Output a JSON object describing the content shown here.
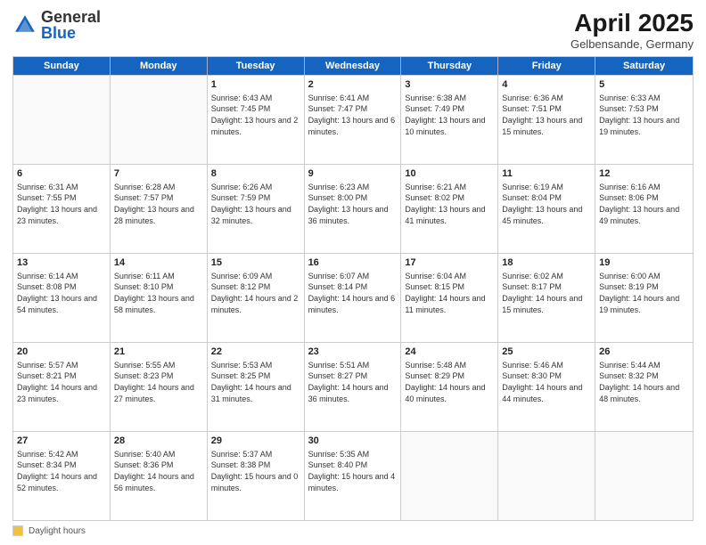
{
  "header": {
    "logo_general": "General",
    "logo_blue": "Blue",
    "month_title": "April 2025",
    "subtitle": "Gelbensande, Germany"
  },
  "days_of_week": [
    "Sunday",
    "Monday",
    "Tuesday",
    "Wednesday",
    "Thursday",
    "Friday",
    "Saturday"
  ],
  "legend_label": "Daylight hours",
  "weeks": [
    [
      {
        "day": "",
        "info": ""
      },
      {
        "day": "",
        "info": ""
      },
      {
        "day": "1",
        "info": "Sunrise: 6:43 AM\nSunset: 7:45 PM\nDaylight: 13 hours and 2 minutes."
      },
      {
        "day": "2",
        "info": "Sunrise: 6:41 AM\nSunset: 7:47 PM\nDaylight: 13 hours and 6 minutes."
      },
      {
        "day": "3",
        "info": "Sunrise: 6:38 AM\nSunset: 7:49 PM\nDaylight: 13 hours and 10 minutes."
      },
      {
        "day": "4",
        "info": "Sunrise: 6:36 AM\nSunset: 7:51 PM\nDaylight: 13 hours and 15 minutes."
      },
      {
        "day": "5",
        "info": "Sunrise: 6:33 AM\nSunset: 7:53 PM\nDaylight: 13 hours and 19 minutes."
      }
    ],
    [
      {
        "day": "6",
        "info": "Sunrise: 6:31 AM\nSunset: 7:55 PM\nDaylight: 13 hours and 23 minutes."
      },
      {
        "day": "7",
        "info": "Sunrise: 6:28 AM\nSunset: 7:57 PM\nDaylight: 13 hours and 28 minutes."
      },
      {
        "day": "8",
        "info": "Sunrise: 6:26 AM\nSunset: 7:59 PM\nDaylight: 13 hours and 32 minutes."
      },
      {
        "day": "9",
        "info": "Sunrise: 6:23 AM\nSunset: 8:00 PM\nDaylight: 13 hours and 36 minutes."
      },
      {
        "day": "10",
        "info": "Sunrise: 6:21 AM\nSunset: 8:02 PM\nDaylight: 13 hours and 41 minutes."
      },
      {
        "day": "11",
        "info": "Sunrise: 6:19 AM\nSunset: 8:04 PM\nDaylight: 13 hours and 45 minutes."
      },
      {
        "day": "12",
        "info": "Sunrise: 6:16 AM\nSunset: 8:06 PM\nDaylight: 13 hours and 49 minutes."
      }
    ],
    [
      {
        "day": "13",
        "info": "Sunrise: 6:14 AM\nSunset: 8:08 PM\nDaylight: 13 hours and 54 minutes."
      },
      {
        "day": "14",
        "info": "Sunrise: 6:11 AM\nSunset: 8:10 PM\nDaylight: 13 hours and 58 minutes."
      },
      {
        "day": "15",
        "info": "Sunrise: 6:09 AM\nSunset: 8:12 PM\nDaylight: 14 hours and 2 minutes."
      },
      {
        "day": "16",
        "info": "Sunrise: 6:07 AM\nSunset: 8:14 PM\nDaylight: 14 hours and 6 minutes."
      },
      {
        "day": "17",
        "info": "Sunrise: 6:04 AM\nSunset: 8:15 PM\nDaylight: 14 hours and 11 minutes."
      },
      {
        "day": "18",
        "info": "Sunrise: 6:02 AM\nSunset: 8:17 PM\nDaylight: 14 hours and 15 minutes."
      },
      {
        "day": "19",
        "info": "Sunrise: 6:00 AM\nSunset: 8:19 PM\nDaylight: 14 hours and 19 minutes."
      }
    ],
    [
      {
        "day": "20",
        "info": "Sunrise: 5:57 AM\nSunset: 8:21 PM\nDaylight: 14 hours and 23 minutes."
      },
      {
        "day": "21",
        "info": "Sunrise: 5:55 AM\nSunset: 8:23 PM\nDaylight: 14 hours and 27 minutes."
      },
      {
        "day": "22",
        "info": "Sunrise: 5:53 AM\nSunset: 8:25 PM\nDaylight: 14 hours and 31 minutes."
      },
      {
        "day": "23",
        "info": "Sunrise: 5:51 AM\nSunset: 8:27 PM\nDaylight: 14 hours and 36 minutes."
      },
      {
        "day": "24",
        "info": "Sunrise: 5:48 AM\nSunset: 8:29 PM\nDaylight: 14 hours and 40 minutes."
      },
      {
        "day": "25",
        "info": "Sunrise: 5:46 AM\nSunset: 8:30 PM\nDaylight: 14 hours and 44 minutes."
      },
      {
        "day": "26",
        "info": "Sunrise: 5:44 AM\nSunset: 8:32 PM\nDaylight: 14 hours and 48 minutes."
      }
    ],
    [
      {
        "day": "27",
        "info": "Sunrise: 5:42 AM\nSunset: 8:34 PM\nDaylight: 14 hours and 52 minutes."
      },
      {
        "day": "28",
        "info": "Sunrise: 5:40 AM\nSunset: 8:36 PM\nDaylight: 14 hours and 56 minutes."
      },
      {
        "day": "29",
        "info": "Sunrise: 5:37 AM\nSunset: 8:38 PM\nDaylight: 15 hours and 0 minutes."
      },
      {
        "day": "30",
        "info": "Sunrise: 5:35 AM\nSunset: 8:40 PM\nDaylight: 15 hours and 4 minutes."
      },
      {
        "day": "",
        "info": ""
      },
      {
        "day": "",
        "info": ""
      },
      {
        "day": "",
        "info": ""
      }
    ]
  ]
}
